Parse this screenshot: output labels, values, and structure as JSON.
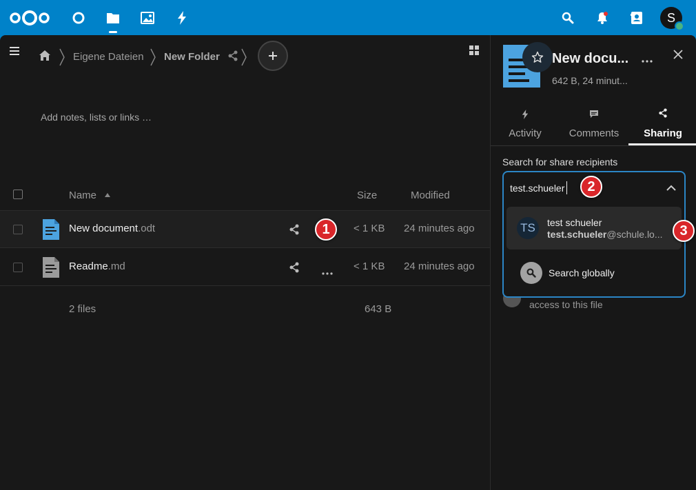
{
  "header": {
    "apps": [
      "dashboard",
      "files",
      "photos",
      "activity"
    ],
    "right_icons": [
      "search",
      "notifications",
      "contacts"
    ],
    "avatar_initial": "S"
  },
  "breadcrumb": {
    "items": [
      "Eigene Dateien",
      "New Folder"
    ]
  },
  "notes_placeholder": "Add notes, lists or links …",
  "table": {
    "headers": {
      "name": "Name",
      "size": "Size",
      "modified": "Modified"
    },
    "rows": [
      {
        "basename": "New document",
        "ext": ".odt",
        "size": "< 1 KB",
        "modified": "24 minutes ago"
      },
      {
        "basename": "Readme",
        "ext": ".md",
        "size": "< 1 KB",
        "modified": "24 minutes ago"
      }
    ],
    "summary": {
      "files": "2 files",
      "size": "643 B"
    }
  },
  "sidebar": {
    "title": "New docu...",
    "subtitle": "642 B, 24 minut...",
    "tabs": [
      "Activity",
      "Comments",
      "Sharing"
    ],
    "active_tab": "Sharing",
    "search_label": "Search for share recipients",
    "search_value": "test.schueler",
    "results": [
      {
        "initials": "TS",
        "name": "test schueler",
        "email_bold": "test.schueler",
        "email_rest": "@schule.lo..."
      }
    ],
    "search_globally": "Search globally",
    "behind_text": "access to this file"
  },
  "annotations": [
    "1",
    "2",
    "3"
  ],
  "colors": {
    "brand": "#0082c9",
    "badge": "#d9262a",
    "doc_blue": "#4ca3e0"
  }
}
